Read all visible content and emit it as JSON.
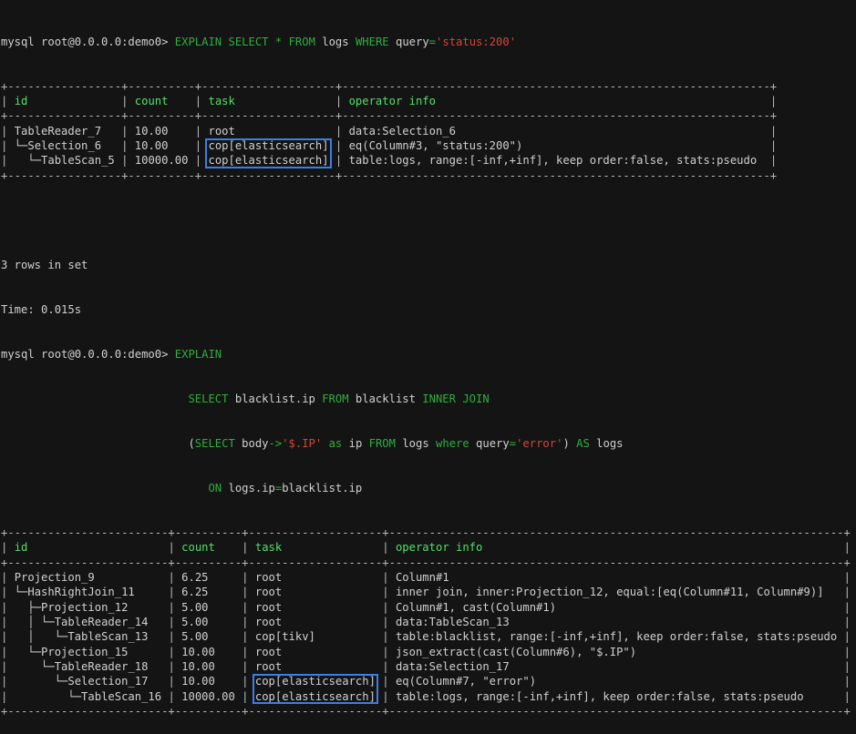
{
  "prompt": "mysql root@0.0.0.0:demo0> ",
  "query1": [
    {
      "t": "EXPLAIN",
      "c": "kw"
    },
    {
      "t": " "
    },
    {
      "t": "SELECT",
      "c": "kw"
    },
    {
      "t": " "
    },
    {
      "t": "*",
      "c": "kw"
    },
    {
      "t": " "
    },
    {
      "t": "FROM",
      "c": "kw"
    },
    {
      "t": " logs "
    },
    {
      "t": "WHERE",
      "c": "kw"
    },
    {
      "t": " query"
    },
    {
      "t": "=",
      "c": "op"
    },
    {
      "t": "'status:200'",
      "c": "str"
    }
  ],
  "table1": {
    "headers": [
      "id",
      "count",
      "task",
      "operator info"
    ],
    "widths": [
      15,
      8,
      18,
      62
    ],
    "rows": [
      {
        "id": "TableReader_7",
        "count": "10.00",
        "task": "root",
        "info": "data:Selection_6",
        "highlight": false
      },
      {
        "id": "└─Selection_6",
        "count": "10.00",
        "task": "cop[elasticsearch]",
        "info": "eq(Column#3, \"status:200\")",
        "highlight": true
      },
      {
        "id": "  └─TableScan_5",
        "count": "10000.00",
        "task": "cop[elasticsearch]",
        "info": "table:logs, range:[-inf,+inf], keep order:false, stats:pseudo",
        "highlight": true
      }
    ]
  },
  "result_summary": "3 rows in set",
  "time": "Time: 0.015s",
  "query2": [
    [
      {
        "t": "EXPLAIN",
        "c": "kw"
      }
    ],
    [
      {
        "t": "SELECT",
        "c": "kw"
      },
      {
        "t": " blacklist.ip "
      },
      {
        "t": "FROM",
        "c": "kw"
      },
      {
        "t": " blacklist "
      },
      {
        "t": "INNER",
        "c": "kw"
      },
      {
        "t": " "
      },
      {
        "t": "JOIN",
        "c": "kw"
      }
    ],
    [
      {
        "t": "("
      },
      {
        "t": "SELECT",
        "c": "kw"
      },
      {
        "t": " body"
      },
      {
        "t": "->",
        "c": "op"
      },
      {
        "t": "'$.IP'",
        "c": "str"
      },
      {
        "t": " "
      },
      {
        "t": "as",
        "c": "kw"
      },
      {
        "t": " ip "
      },
      {
        "t": "FROM",
        "c": "kw"
      },
      {
        "t": " logs "
      },
      {
        "t": "where",
        "c": "kw"
      },
      {
        "t": " query"
      },
      {
        "t": "=",
        "c": "op"
      },
      {
        "t": "'error'",
        "c": "str"
      },
      {
        "t": ") "
      },
      {
        "t": "AS",
        "c": "kw"
      },
      {
        "t": " logs"
      }
    ],
    [
      {
        "t": "   "
      },
      {
        "t": "ON",
        "c": "kw"
      },
      {
        "t": " logs.ip"
      },
      {
        "t": "=",
        "c": "op"
      },
      {
        "t": "blacklist.ip"
      }
    ]
  ],
  "table2": {
    "headers": [
      "id",
      "count",
      "task",
      "operator info"
    ],
    "widths": [
      22,
      8,
      18,
      66
    ],
    "rows": [
      {
        "id": "Projection_9",
        "count": "6.25",
        "task": "root",
        "info": "Column#1",
        "highlight": false
      },
      {
        "id": "└─HashRightJoin_11",
        "count": "6.25",
        "task": "root",
        "info": "inner join, inner:Projection_12, equal:[eq(Column#11, Column#9)]",
        "highlight": false
      },
      {
        "id": "  ├─Projection_12",
        "count": "5.00",
        "task": "root",
        "info": "Column#1, cast(Column#1)",
        "highlight": false
      },
      {
        "id": "  │ └─TableReader_14",
        "count": "5.00",
        "task": "root",
        "info": "data:TableScan_13",
        "highlight": false
      },
      {
        "id": "  │   └─TableScan_13",
        "count": "5.00",
        "task": "cop[tikv]",
        "info": "table:blacklist, range:[-inf,+inf], keep order:false, stats:pseudo",
        "highlight": false
      },
      {
        "id": "  └─Projection_15",
        "count": "10.00",
        "task": "root",
        "info": "json_extract(cast(Column#6), \"$.IP\")",
        "highlight": false
      },
      {
        "id": "    └─TableReader_18",
        "count": "10.00",
        "task": "root",
        "info": "data:Selection_17",
        "highlight": false
      },
      {
        "id": "      └─Selection_17",
        "count": "10.00",
        "task": "cop[elasticsearch]",
        "info": "eq(Column#7, \"error\")",
        "highlight": true
      },
      {
        "id": "        └─TableScan_16",
        "count": "10000.00",
        "task": "cop[elasticsearch]",
        "info": "table:logs, range:[-inf,+inf], keep order:false, stats:pseudo",
        "highlight": true
      }
    ]
  },
  "colors": {
    "background": "#141414",
    "text": "#d0d0d0",
    "keyword": "#2fae3c",
    "string": "#d0473a",
    "header": "#52e06a",
    "highlight_box": "#3a7fe6"
  }
}
